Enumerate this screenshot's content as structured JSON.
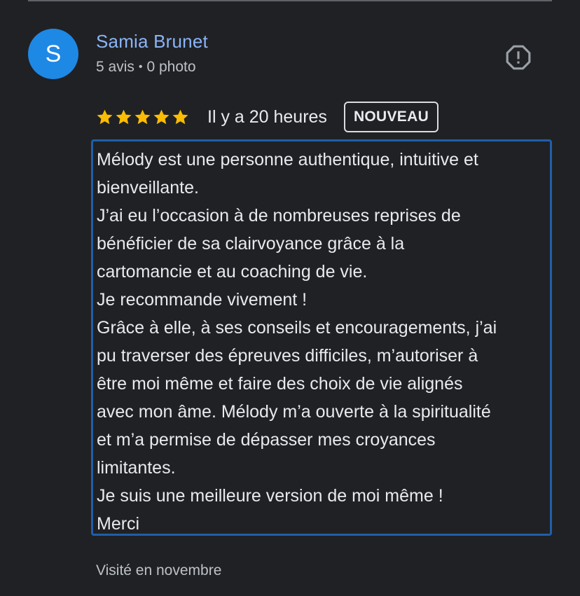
{
  "review": {
    "author": {
      "initial": "S",
      "name": "Samia Brunet",
      "review_count": "5 avis",
      "separator": "•",
      "photo_count": "0 photo"
    },
    "report_icon": "report-flag-icon",
    "rating": 5,
    "rating_max": 5,
    "time_ago": "Il y a 20 heures",
    "badge": "NOUVEAU",
    "text_lines": [
      "Mélody est une personne authentique, intuitive et",
      "bienveillante.",
      "J’ai eu l’occasion à de nombreuses reprises de",
      "bénéficier de sa clairvoyance grâce à la",
      "cartomancie et au coaching de vie.",
      "Je recommande vivement !",
      "Grâce à elle, à ses conseils et encouragements, j’ai",
      "pu traverser des épreuves difficiles, m’autoriser à",
      "être moi même et faire des choix de vie alignés",
      "avec mon âme. Mélody m’a ouverte à la spiritualité",
      "et m’a permise de dépasser mes croyances",
      "limitantes.",
      "Je suis une meilleure version de moi même !",
      "Merci"
    ],
    "visited": "Visité en novembre"
  },
  "colors": {
    "background": "#202124",
    "author_name": "#8ab4f8",
    "avatar": "#1e88e5",
    "star": "#fbbc04",
    "highlight_border": "#1f5fa8"
  }
}
